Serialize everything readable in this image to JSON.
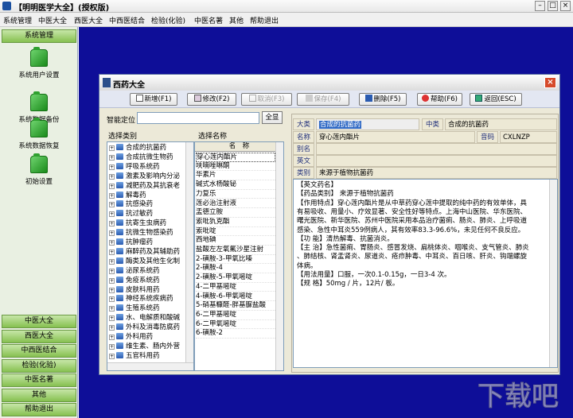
{
  "window_title": "【明明医学大全】(授权版)",
  "menu": [
    "系统管理",
    "中医大全",
    "西医大全",
    "中西医结合",
    "检验(化验)",
    "中医名著",
    "其他",
    "帮助退出"
  ],
  "sidebar": {
    "header": "系统管理",
    "items": [
      "系统用户设置",
      "系统数据备份",
      "系统数据恢复",
      "初始设置"
    ],
    "bottom": [
      "中医大全",
      "西医大全",
      "中西医结合",
      "检验(化验)",
      "中医名著",
      "其他",
      "帮助退出"
    ]
  },
  "dialog": {
    "title": "西药大全",
    "buttons": [
      {
        "label": "新增(F1)",
        "enabled": true,
        "icon": "document-icon"
      },
      {
        "label": "修改(F2)",
        "enabled": true,
        "icon": "edit-icon"
      },
      {
        "label": "取消(F3)",
        "enabled": false,
        "icon": "undo-icon"
      },
      {
        "label": "保存(F4)",
        "enabled": false,
        "icon": "save-icon"
      },
      {
        "label": "删除(F5)",
        "enabled": true,
        "icon": "delete-icon"
      },
      {
        "label": "帮助(F6)",
        "enabled": true,
        "icon": "help-icon"
      },
      {
        "label": "返回(ESC)",
        "enabled": true,
        "icon": "back-icon"
      }
    ],
    "search_label": "智能定位",
    "search_value": "",
    "all_button": "全显",
    "category_header": "选择类别",
    "categories": [
      "合成的抗菌药",
      "合成抗微生物药",
      "呼吸系统药",
      "激素及影响内分泌",
      "减肥药及其抗衰老",
      "解毒药",
      "抗感染药",
      "抗过敏药",
      "抗寄生虫病药",
      "抗微生物感染药",
      "抗肿瘤药",
      "麻醉药及其辅助药",
      "酶类及其他生化制",
      "泌尿系统药",
      "免疫系统药",
      "皮肤科用药",
      "神经系统疾病药",
      "生殖系统药",
      "水、电解质和酸碱",
      "外科及消毒防腐药",
      "外科用药",
      "维生素、肠内外营",
      "五官科用药"
    ],
    "name_header": "选择名称",
    "name_col": "名　称",
    "names": [
      "穿心莲内酯片",
      "呋喃唑啉酮",
      "华素片",
      "碱式水杨酸铋",
      "力复乐",
      "莲必治注射液",
      "盂德立胺",
      "索吡犰克酯",
      "索吡啶",
      "西地碘",
      "盐酸左左氧氟沙星注射",
      "2-磺胺-3-甲氧比嗪",
      "2-磺胺-4",
      "2-磺胺-5-甲氧嘧啶",
      "4-二甲基嘧啶",
      "4-磺胺-6-甲氧嘧啶",
      "5-硝基糠醛-胖基脲盐酸",
      "6-二甲基嘧啶",
      "6-二甲氧嘧啶",
      "6-磺胺-2"
    ],
    "fields": {
      "dalei_label": "大类",
      "dalei_value": "合成的抗菌药",
      "zhonglei_label": "中类",
      "zhonglei_value": "合成的抗菌药",
      "name_label": "名称",
      "name_value": "穿心莲内酯片",
      "code_label": "音码",
      "code_value": "CXLNZP",
      "alias_label": "别名",
      "alias_value": "",
      "eng_label": "英文名",
      "eng_value": "",
      "type_label": "类别",
      "type_value": "来源于植物抗菌药"
    },
    "detail_lines": [
      "【英文药名】",
      "【药品类别】 来源于植物抗菌药",
      "【作用特点】穿心莲内酯片是从中草药穿心莲中提取的纯中药的有效单体，具",
      "有易吸收、用量小、疗效显著、安全性好等特点。上海中山医院、华东医院、",
      "曙光医院、新华医院、苏州中医院采用本品治疗菌痢、肠炎、肺炎、上呼吸道",
      "感染、急性中耳炎559例病人，其有效率83.3-96.6%，未见任何不良反应。",
      "【功 能】清热解毒、抗菌消炎。",
      "【主 治】急性菌痢、胃肠炎、感冒发烧、扁桃体炎、咽喉炎、支气管炎、肺炎",
      "、肺结核、肾盂肾炎、尿道炎、疮疖肿毒、中耳炎、百日咳、肝炎、钩端螺旋",
      "体病。",
      "【用法用量】口服，一次0.1-0.15g，一日3-4 次。",
      "【规 格】50mg / 片，12片/ 板。"
    ]
  },
  "watermark": "下载吧"
}
